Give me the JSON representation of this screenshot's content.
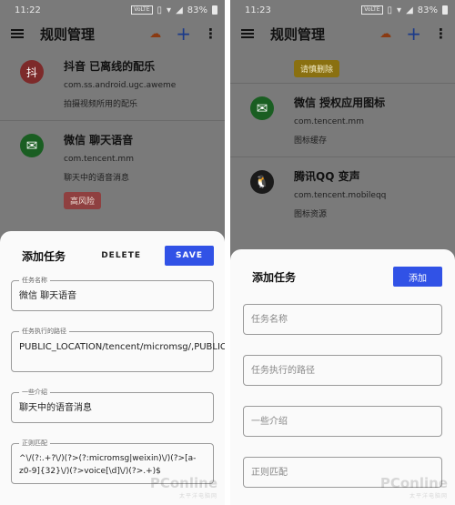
{
  "left": {
    "status": {
      "time": "11:22",
      "volte": "VoLTE",
      "battery": "83%"
    },
    "toolbar": {
      "title": "规则管理",
      "cloud_icon": "cloud-icon",
      "add_icon": "plus-icon",
      "more_icon": "more-vert-icon"
    },
    "rules": [
      {
        "icon": "抖",
        "name": "抖音 已离线的配乐",
        "package": "com.ss.android.ugc.aweme",
        "desc": "拍摄视频所用的配乐",
        "badge": ""
      },
      {
        "icon": "✉",
        "name": "微信 聊天语音",
        "package": "com.tencent.mm",
        "desc": "聊天中的语音消息",
        "badge": "高风险"
      }
    ],
    "sheet": {
      "title": "添加任务",
      "delete_label": "DELETE",
      "save_label": "SAVE",
      "fields": [
        {
          "label": "任务名称",
          "value": "微信 聊天语音"
        },
        {
          "label": "任务执行的路径",
          "value": "PUBLIC_LOCATION/tencent/micromsg/,PUBLIC_LOCATION/tencent/weixin/"
        },
        {
          "label": "一些介绍",
          "value": "聊天中的语音消息"
        },
        {
          "label": "正则匹配",
          "value": "^\\/(?:.+?\\/)(?>(?:micromsg|weixin)\\/)(?>[a-z0-9]{32}\\/)(?>voice[\\d]\\/)(?>.+)$"
        }
      ]
    }
  },
  "right": {
    "status": {
      "time": "11:23",
      "volte": "VoLTE",
      "battery": "83%"
    },
    "toolbar": {
      "title": "规则管理",
      "cloud_icon": "cloud-icon",
      "add_icon": "plus-icon",
      "more_icon": "more-vert-icon"
    },
    "top_badge": "请慎删除",
    "rules": [
      {
        "icon": "✉",
        "name": "微信 授权应用图标",
        "package": "com.tencent.mm",
        "desc": "图标缓存"
      },
      {
        "icon": "🐧",
        "name": "腾讯QQ 变声",
        "package": "com.tencent.mobileqq",
        "desc": "图标资源"
      }
    ],
    "sheet": {
      "title": "添加任务",
      "add_label": "添加",
      "placeholders": [
        "任务名称",
        "任务执行的路径",
        "一些介绍",
        "正则匹配"
      ]
    }
  },
  "watermark": {
    "brand": "PConline",
    "sub": "太平洋电脑网"
  },
  "colors": {
    "accent": "#3152e6",
    "danger": "#8f4040",
    "warning": "#8a7010"
  }
}
